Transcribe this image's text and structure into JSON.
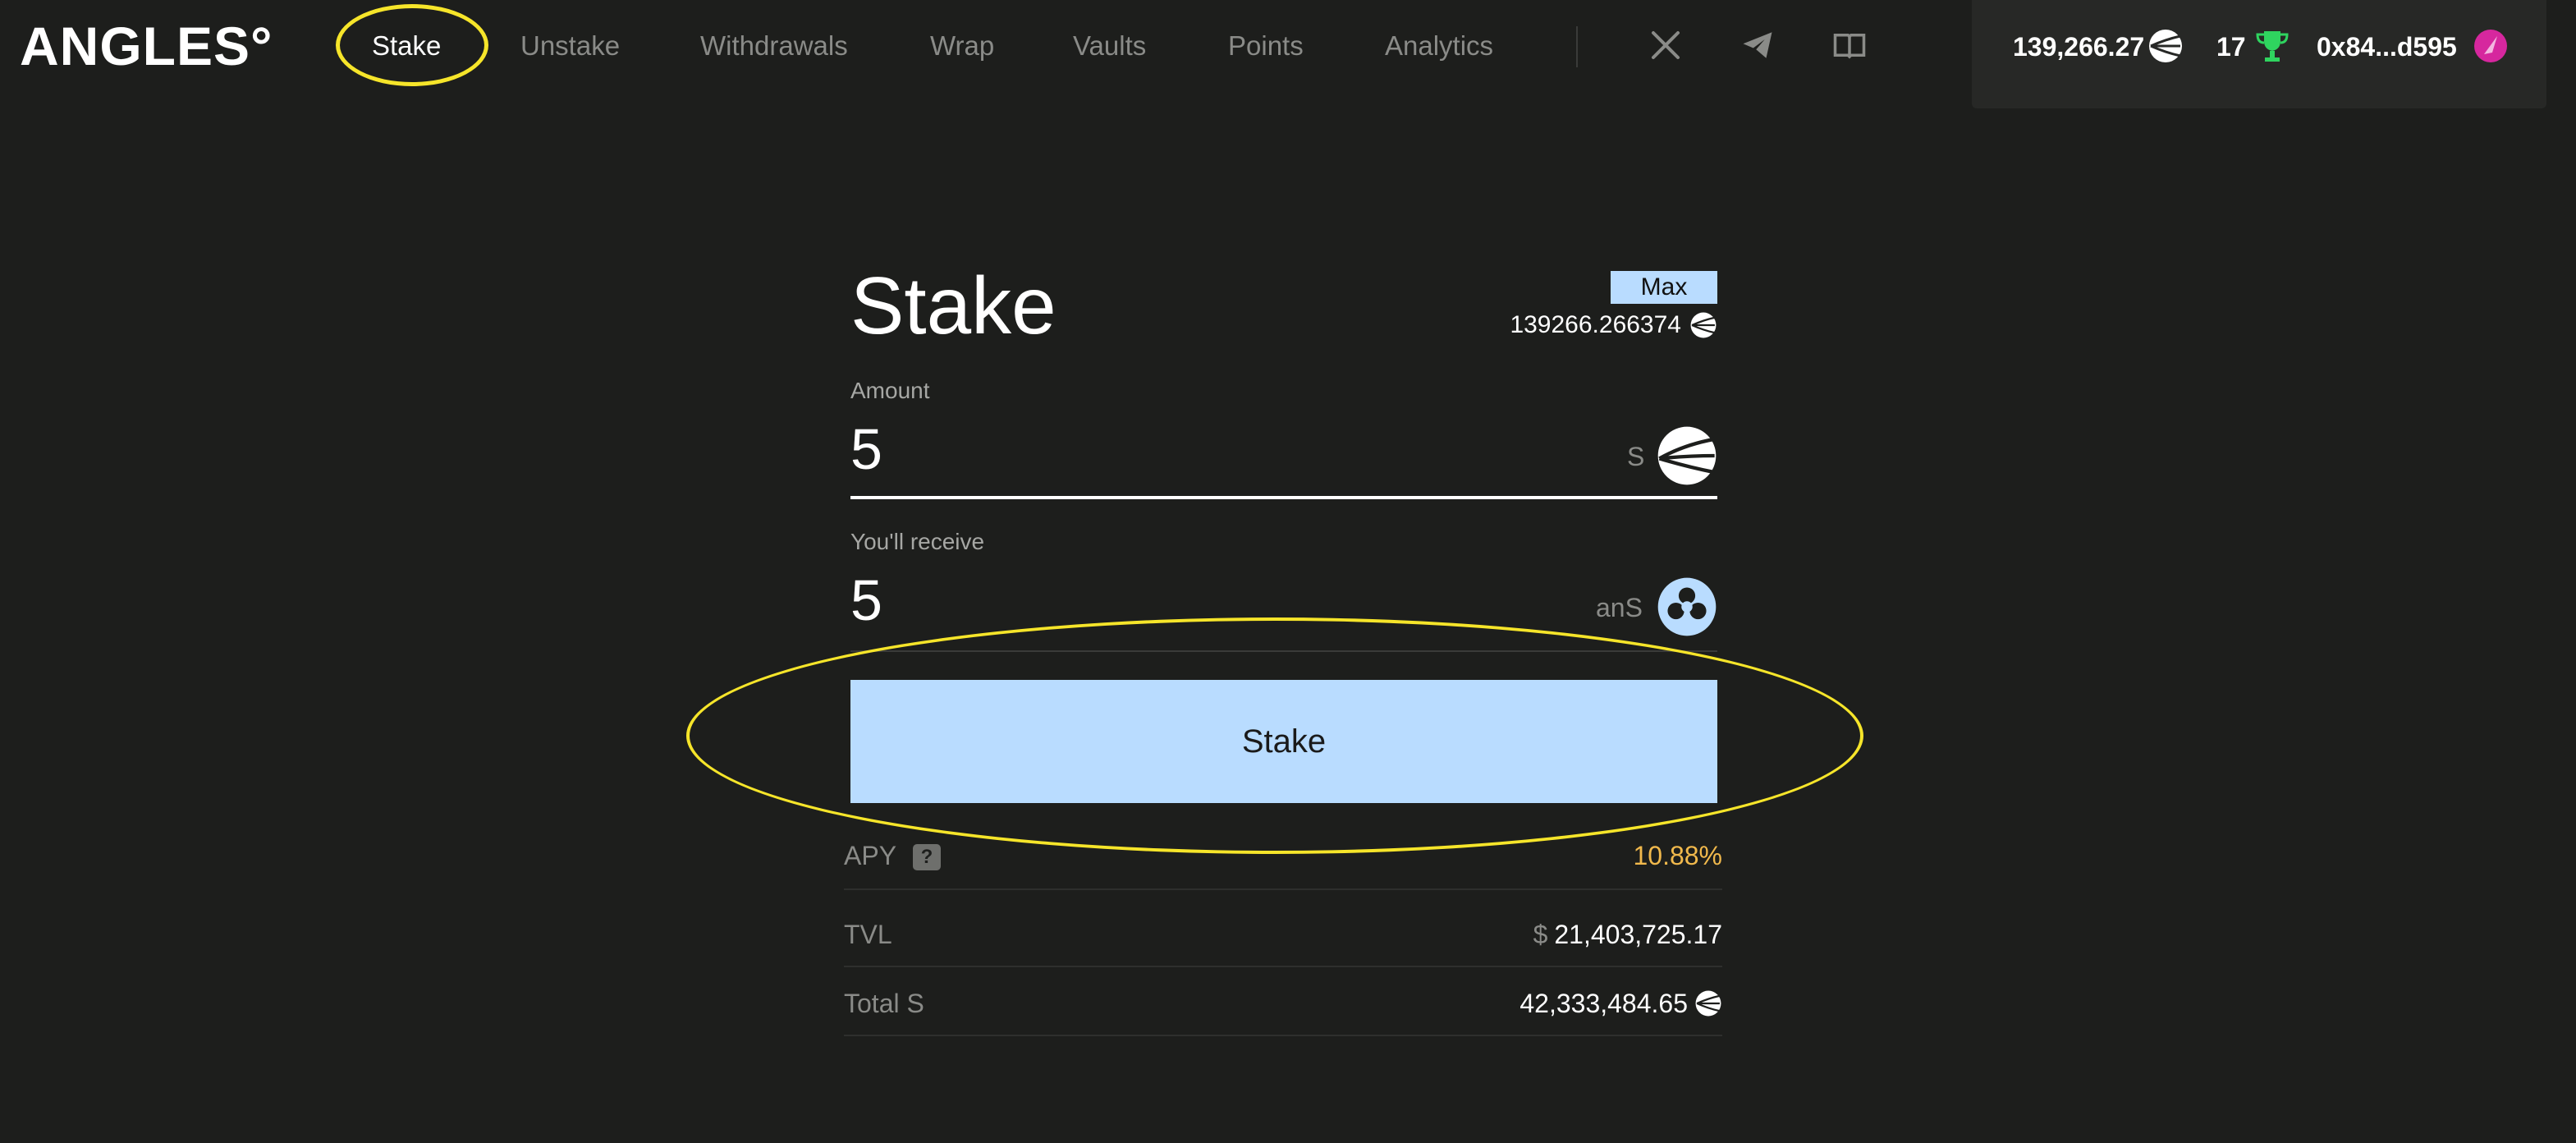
{
  "header": {
    "logo": "ANGLES°",
    "nav": [
      {
        "label": "Stake"
      },
      {
        "label": "Unstake"
      },
      {
        "label": "Withdrawals"
      },
      {
        "label": "Wrap"
      },
      {
        "label": "Vaults"
      },
      {
        "label": "Points"
      },
      {
        "label": "Analytics"
      }
    ],
    "social_icons": [
      "x-icon",
      "telegram-icon",
      "book-icon"
    ],
    "wallet": {
      "balance": "139,266.27",
      "points": "17",
      "address": "0x84...d595"
    }
  },
  "stake_card": {
    "title": "Stake",
    "max_label": "Max",
    "available_balance": "139266.266374",
    "amount": {
      "label": "Amount",
      "value": "5",
      "token": "S"
    },
    "receive": {
      "label": "You'll receive",
      "value": "5",
      "token": "anS"
    },
    "submit_label": "Stake",
    "stats": {
      "apy": {
        "label": "APY",
        "help": "?",
        "value": "10.88%"
      },
      "tvl": {
        "label": "TVL",
        "currency": "$",
        "value": "21,403,725.17"
      },
      "total": {
        "label": "Total S",
        "value": "42,333,484.65"
      }
    }
  },
  "colors": {
    "background": "#1d1e1c",
    "accent_button": "#b9dcff",
    "apy_value": "#f1b94c",
    "highlight_annotation": "#f6e52a",
    "trophy": "#2fd45f"
  }
}
